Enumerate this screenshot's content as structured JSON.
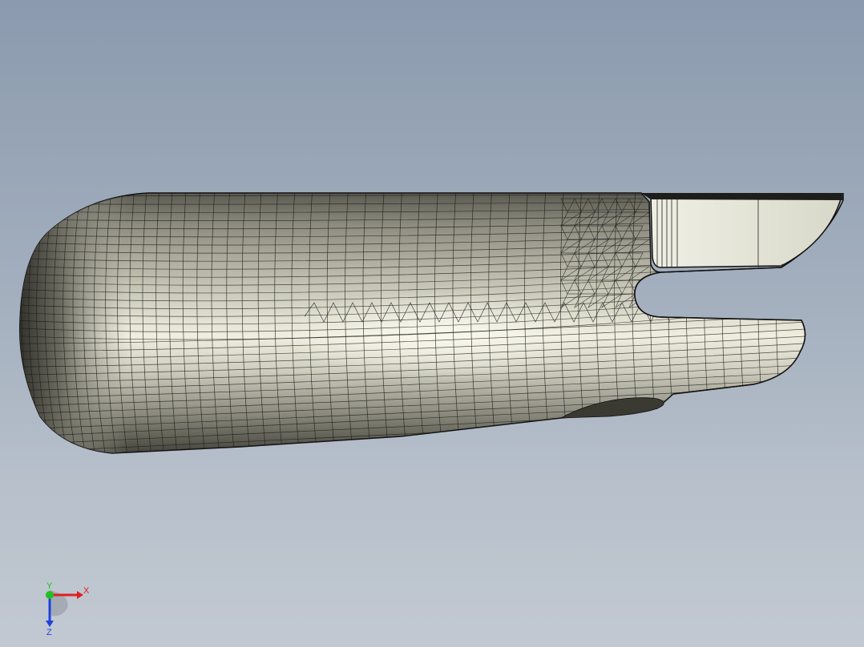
{
  "view": {
    "background_top": "#8b9aae",
    "background_bottom": "#c2c9d2"
  },
  "model": {
    "surface_color": "#c9c8b8",
    "highlight_color": "#f4f3e6",
    "shadow_color": "#3d3d35",
    "mesh_color": "#1a1a1a",
    "flat_face_color": "#dcdccf"
  },
  "triad": {
    "x_label": "X",
    "y_label": "Y",
    "z_label": "Z",
    "x_color": "#e02020",
    "y_color": "#20c020",
    "z_color": "#2040e0"
  }
}
